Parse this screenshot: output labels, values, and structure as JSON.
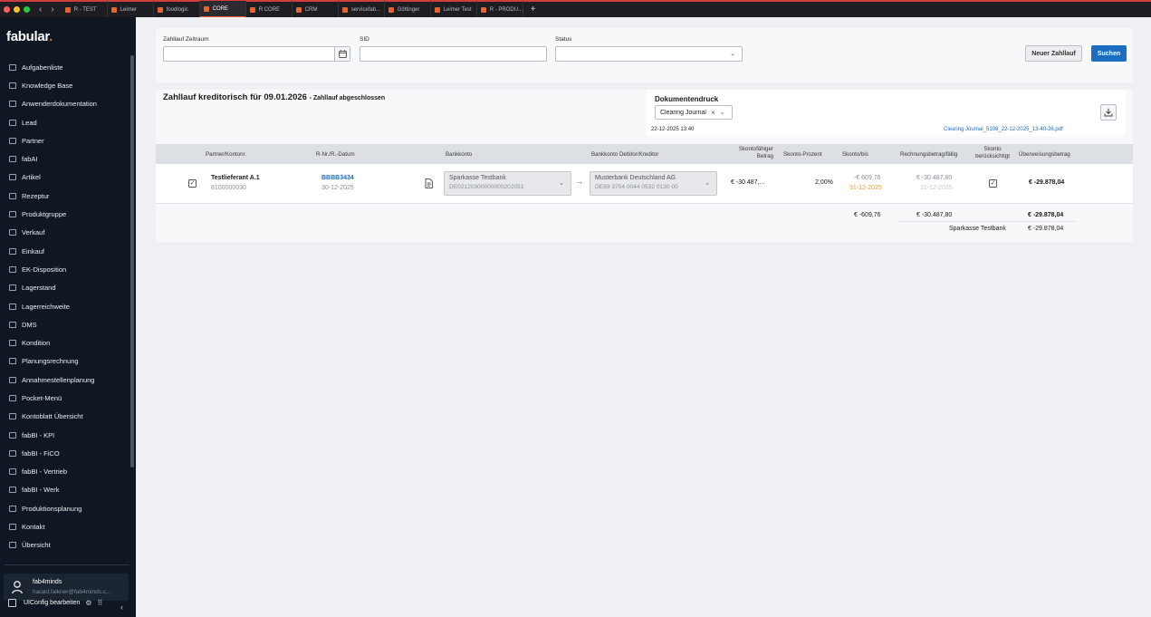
{
  "browser": {
    "tabs": [
      {
        "label": "R - TEST",
        "active": false
      },
      {
        "label": "Leimer",
        "active": false
      },
      {
        "label": "foodlogic",
        "active": false
      },
      {
        "label": "CORE",
        "active": true
      },
      {
        "label": "R CORE",
        "active": false
      },
      {
        "label": "CRM",
        "active": false
      },
      {
        "label": "servicefab...",
        "active": false
      },
      {
        "label": "Göttinger",
        "active": false
      },
      {
        "label": "Leimer Test",
        "active": false
      },
      {
        "label": "R - PRODU...",
        "active": false
      }
    ],
    "add_tab": "+",
    "back": "‹",
    "forward": "›"
  },
  "sidebar": {
    "logo": "fabular",
    "logo_dot": ".",
    "items": [
      {
        "label": "Aufgabenliste"
      },
      {
        "label": "Knowledge Base"
      },
      {
        "label": "Anwenderdokumentation"
      },
      {
        "label": "Lead"
      },
      {
        "label": "Partner"
      },
      {
        "label": "fabAI"
      },
      {
        "label": "Artikel"
      },
      {
        "label": "Rezeptur"
      },
      {
        "label": "Produktgruppe"
      },
      {
        "label": "Verkauf"
      },
      {
        "label": "Einkauf"
      },
      {
        "label": "EK-Disposition"
      },
      {
        "label": "Lagerstand"
      },
      {
        "label": "Lagerreichweite"
      },
      {
        "label": "DMS"
      },
      {
        "label": "Kondition"
      },
      {
        "label": "Planungsrechnung"
      },
      {
        "label": "Annahmestellenplanung"
      },
      {
        "label": "Pocket-Menü"
      },
      {
        "label": "Kontoblatt Übersicht"
      },
      {
        "label": "fabBI - KPI"
      },
      {
        "label": "fabBI - FiCO"
      },
      {
        "label": "fabBI - Vertrieb"
      },
      {
        "label": "fabBI - Werk"
      },
      {
        "label": "Produktionsplanung"
      },
      {
        "label": "Kontakt"
      },
      {
        "label": "Übersicht"
      }
    ],
    "user": {
      "name": "fab4minds",
      "email": "harald.falkner@fab4minds.c..."
    },
    "uiconfig_label": "UIConfig bearbeiten",
    "collapse": "‹"
  },
  "filters": {
    "zeitraum_label": "Zahllauf Zeitraum",
    "zeitraum_value": "",
    "sid_label": "SID",
    "sid_value": "",
    "status_label": "Status",
    "status_value": "",
    "new_button": "Neuer Zahllauf",
    "search_button": "Suchen"
  },
  "run": {
    "title": "Zahllauf kreditorisch für 09.01.2026",
    "subtitle": "- Zahllauf abgeschlossen",
    "doc": {
      "title": "Dokumentendruck",
      "selected": "Clearing Journal",
      "date": "22-12-2025 13:40",
      "file": "Clearing Journal_5108_22-12-2025_13-40-26.pdf"
    },
    "columns": {
      "partner": "Partner/Kontonr.",
      "rnr": "R-Nr./R.-Datum",
      "bankkonto": "Bankkonto",
      "bankkonto_dk": "Bankkonto Debitor/Kreditor",
      "skontofaehig_1": "Skontofähiger",
      "skontofaehig_2": "Betrag",
      "skonto_prozent": "Skonto-Prozent",
      "skonto_bis": "Skonto/bis",
      "rechnungsbetrag": "Rechnungsbetrag/fällig",
      "skonto_ber_1": "Skonto",
      "skonto_ber_2": "berücksichtigt",
      "ueberweisung": "Überweisungsbetrag"
    },
    "rows": [
      {
        "selected": true,
        "partner": "Testlieferant A.1",
        "kontonr": "8100000030",
        "rnr": "BBBB3434",
        "rdatum": "30-12-2025",
        "bank_name": "Sparkasse Testbank",
        "bank_iban": "DE02120300000000202051",
        "arrow": "→",
        "dk_name": "Musterbank Deutschland AG",
        "dk_iban": "DE89 3704 0044 0532 0130 00",
        "skontofaehig": "€ -30.487,...",
        "skonto_prozent": "2,00%",
        "skonto": "-€ 609,76",
        "skonto_bis": "31-12-2025",
        "rechnungsbetrag": "€ -30.487,80",
        "faellig": "31-12-2025",
        "skonto_beruecksichtigt": true,
        "ueberweisung": "€ -29.878,04"
      }
    ],
    "totals": {
      "skonto": "€ -609,76",
      "rechnungsbetrag": "€ -30.487,80",
      "ueberweisung": "€ -29.878,04",
      "bank_label": "Sparkasse Testbank",
      "bank_total": "€ -29.878,04"
    }
  },
  "colors": {
    "accent": "#e5642f",
    "primary_button": "#1b6ec2",
    "sidebar_bg": "#0f1822",
    "skonto_date": "#e5a23a"
  }
}
